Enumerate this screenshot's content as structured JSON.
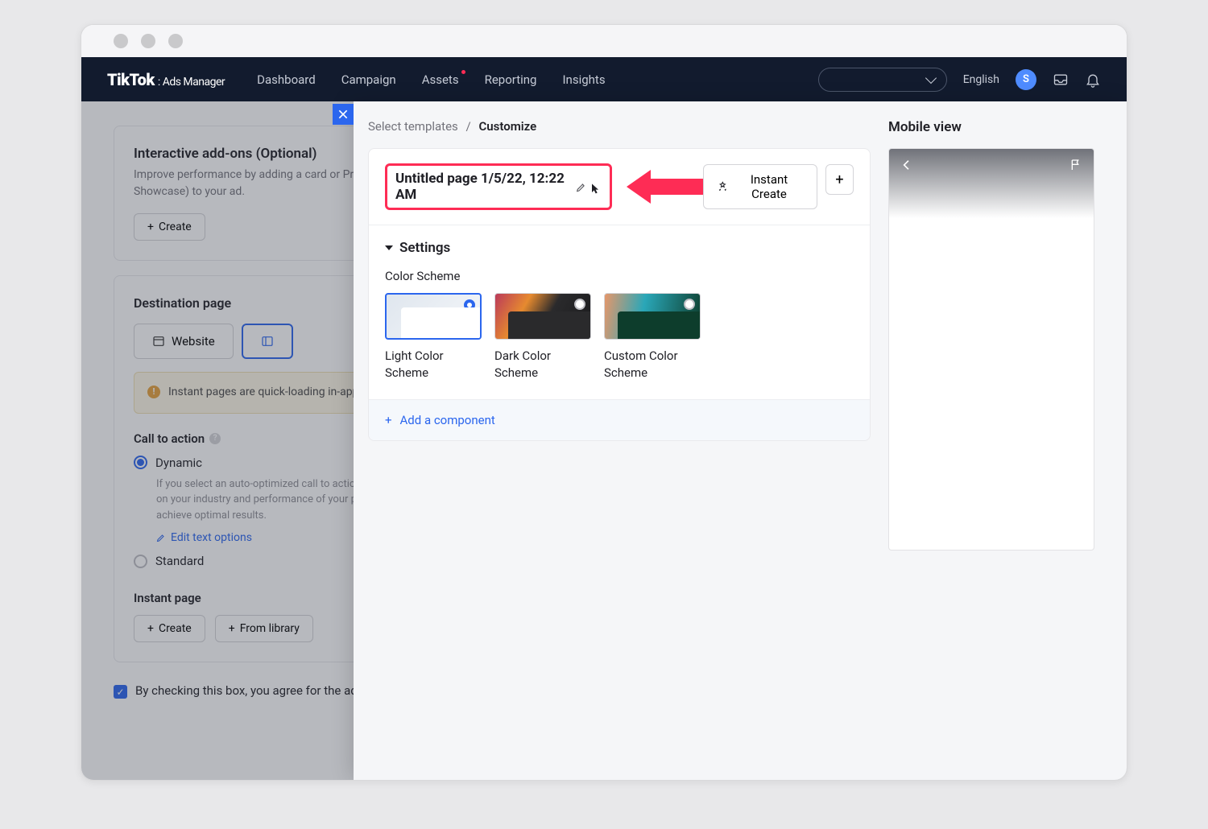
{
  "browser": {
    "dots": 3
  },
  "topbar": {
    "brand": "TikTok",
    "brand_sub": ": Ads Manager",
    "nav": [
      "Dashboard",
      "Campaign",
      "Assets",
      "Reporting",
      "Insights"
    ],
    "nav_badge_index": 2,
    "language": "English",
    "avatar_initial": "S"
  },
  "bg": {
    "addons": {
      "heading": "Interactive add-ons (Optional)",
      "desc": "Improve performance by adding a card or Premium add-on type (Super Like, Interactive Gesture or Pop-out Showcase) to your ad.",
      "create": "Create"
    },
    "destination": {
      "heading": "Destination page",
      "tab_website": "Website",
      "tab_other": "",
      "notice": "Instant pages are quick-loading in-app landing pages that open when someone taps your ad. Please note that instant page ads cannot be boosted or promoted outside of TikTok."
    },
    "cta": {
      "heading": "Call to action",
      "dynamic": "Dynamic",
      "dynamic_desc": "If you select an auto-optimized call to action, the system will automatically choose CTA text for your ads based on your industry and performance of your previous ads. Different CTA text will be shown to different users to achieve optimal results.",
      "edit_text": "Edit text options",
      "standard": "Standard"
    },
    "instant": {
      "heading": "Instant page",
      "create": "Create",
      "from_library": "From library"
    },
    "agree": "By checking this box, you agree for the ad creative to be shared along with performance metrics of the campaign with the creator."
  },
  "panel": {
    "breadcrumb": {
      "select": "Select templates",
      "current": "Customize"
    },
    "page_title": "Untitled page 1/5/22, 12:22 AM",
    "instant_create": "Instant Create",
    "settings_heading": "Settings",
    "color_scheme_heading": "Color Scheme",
    "schemes": [
      {
        "label": "Light Color Scheme",
        "selected": true
      },
      {
        "label": "Dark Color Scheme",
        "selected": false
      },
      {
        "label": "Custom Color Scheme",
        "selected": false
      }
    ],
    "add_component": "Add a component"
  },
  "preview": {
    "heading": "Mobile view"
  }
}
